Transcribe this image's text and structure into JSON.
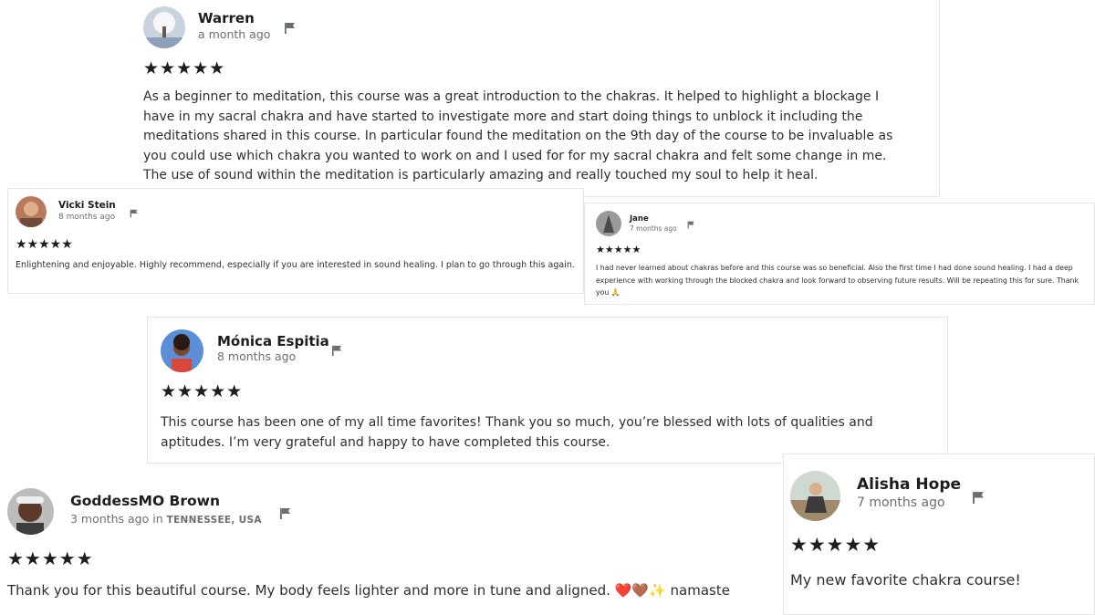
{
  "reviews": [
    {
      "name": "Warren",
      "time": "a month ago",
      "location": "",
      "rating": 5,
      "stars": "★★★★★",
      "text": "As a beginner to meditation, this course was a great introduction to the chakras. It helped to highlight a blockage I have in my sacral chakra and have started to investigate more and start doing things to unblock it including the meditations shared in this course. In particular found the meditation on the 9th day of the course to be invaluable as you could use which chakra you wanted to work on and I used for for my sacral chakra and felt some change in me. The use of sound within the meditation is particularly amazing and really touched my soul to help it heal.",
      "avatar_color": "#8fa1b8"
    },
    {
      "name": "Vicki Stein",
      "time": "8 months ago",
      "location": "",
      "rating": 5,
      "stars": "★★★★★",
      "text": "Enlightening and enjoyable. Highly recommend, especially if you are interested in sound healing. I plan to go through this again.",
      "avatar_color": "#b77a5a"
    },
    {
      "name": "Jane",
      "time": "7 months ago",
      "location": "",
      "rating": 5,
      "stars": "★★★★★",
      "text": "I had never learned about chakras before and this course was so beneficial. Also the first time I had done sound healing. I had a deep experience with working through the blocked chakra and look forward to observing future results. Will be repeating this for sure. Thank you 🙏",
      "avatar_color": "#7d7d7d"
    },
    {
      "name": "Mónica Espitia",
      "time": "8 months ago",
      "location": "",
      "rating": 5,
      "stars": "★★★★★",
      "text": "This course has been one of my all time favorites! Thank you so much, you’re blessed with lots of qualities and aptitudes. I’m very grateful and happy to have completed this course.",
      "avatar_color": "#5b8ed6"
    },
    {
      "name": "GoddessMO Brown",
      "time": "3 months ago",
      "location_prefix": "in",
      "location": "TENNESSEE, USA",
      "rating": 5,
      "stars": "★★★★★",
      "text": "Thank you for this beautiful course. My body feels lighter and more in tune and aligned. ❤️🤎✨ namaste",
      "avatar_color": "#4a4a4a"
    },
    {
      "name": "Alisha Hope",
      "time": "7 months ago",
      "location": "",
      "rating": 5,
      "stars": "★★★★★",
      "text": "My new favorite chakra course!",
      "avatar_color": "#a3b6a4"
    }
  ]
}
